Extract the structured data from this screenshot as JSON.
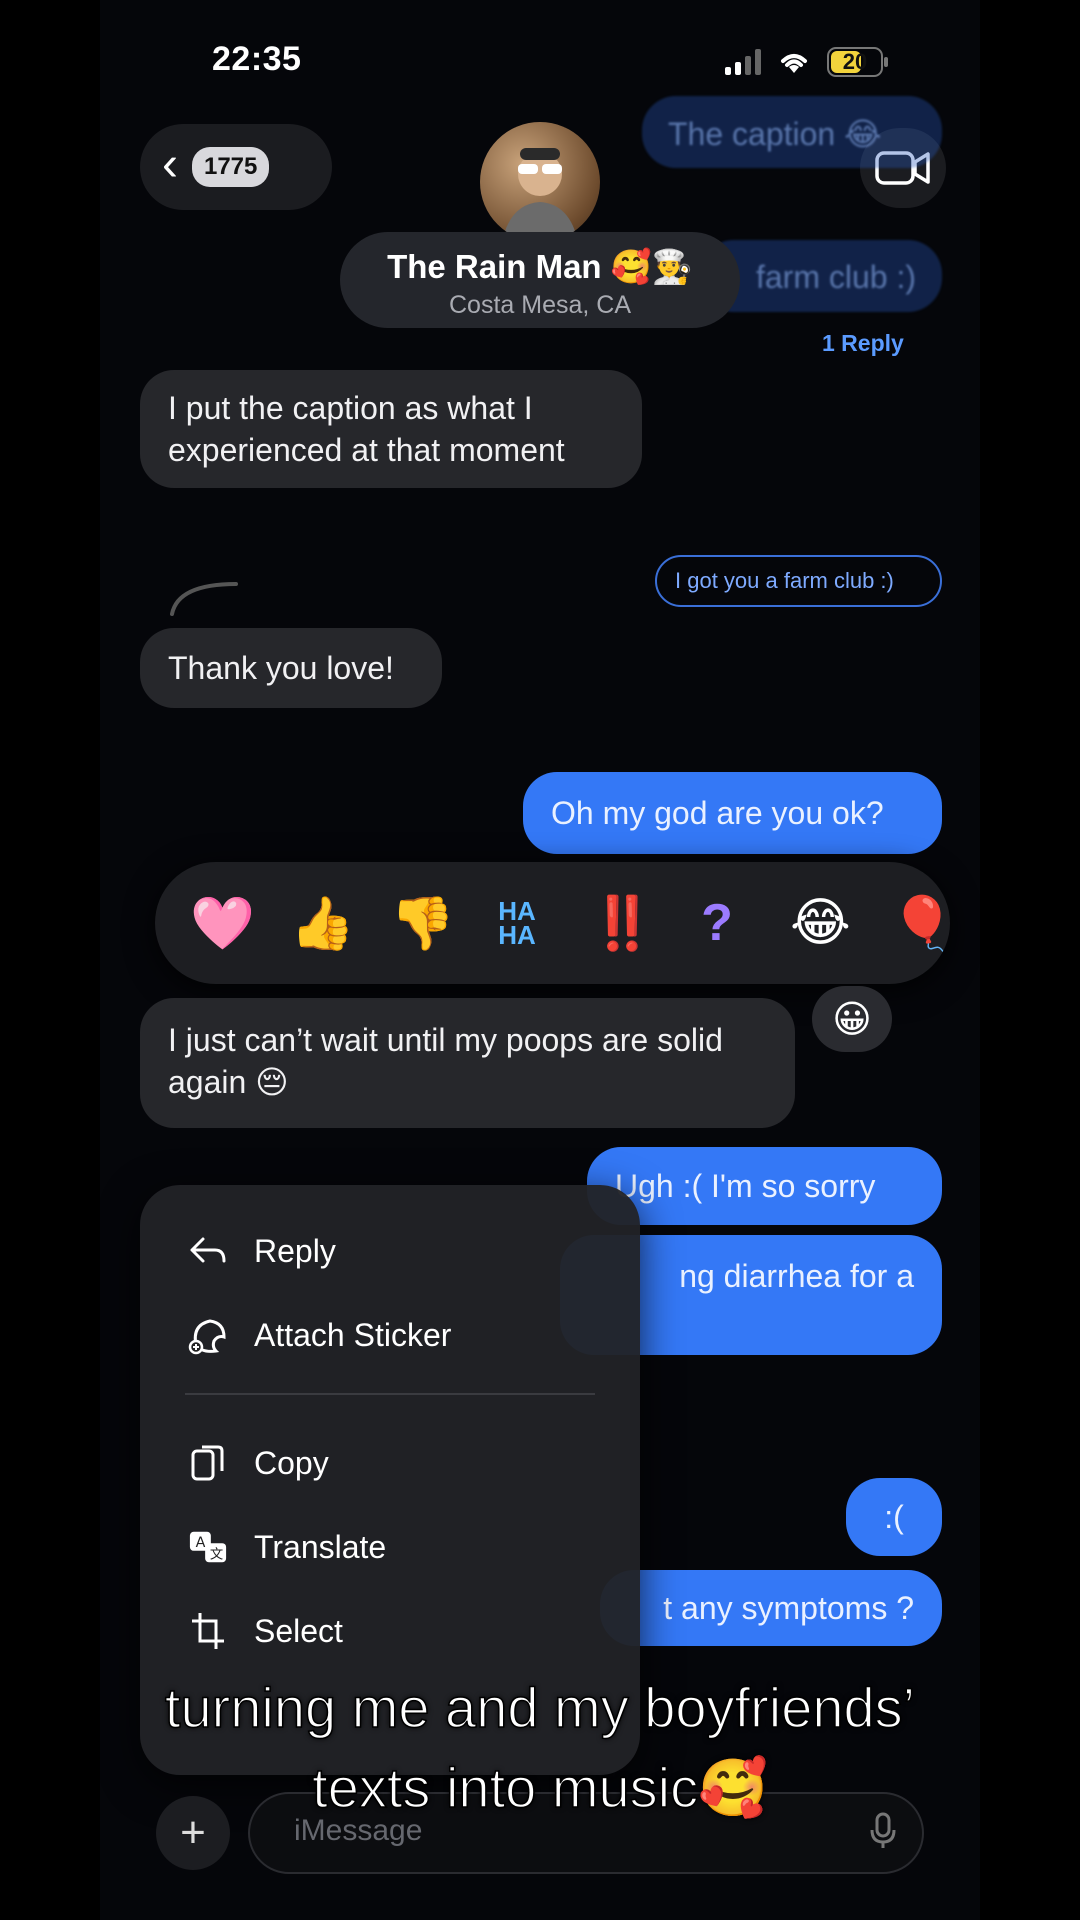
{
  "status": {
    "time": "22:35",
    "battery": "20"
  },
  "header": {
    "back_count": "1775",
    "contact_name": "The Rain Man 🥰👨‍🍳",
    "contact_location": "Costa Mesa, CA"
  },
  "messages": {
    "ghost_caption": "The caption 😂",
    "ghost_farm": "farm club :)",
    "reply_count": "1 Reply",
    "in_caption": "I put the caption as what I experienced at that moment",
    "reply_preview": "I got you a farm club :)",
    "in_thanks": "Thank you love!",
    "out_ok": "Oh my god are you ok?",
    "in_poops": "I just can’t wait until my poops are solid again 😔",
    "out_sorry": "Ugh :( I'm so sorry",
    "out_diarrhea": "ng diarrhea for a",
    "out_sad": ":(",
    "out_symptoms": "t any symptoms ?"
  },
  "reactions": [
    "🩷",
    "👍",
    "👎",
    "HA HA",
    "‼️",
    "?",
    "😂",
    "🎈"
  ],
  "reaction_more": "😀",
  "menu": {
    "reply": "Reply",
    "attach_sticker": "Attach Sticker",
    "copy": "Copy",
    "translate": "Translate",
    "select": "Select"
  },
  "input": {
    "placeholder": "iMessage"
  },
  "caption": {
    "line1": "turning me and my boyfriends’",
    "line2": "texts into music🥰"
  },
  "colors": {
    "outgoing": "#3478f6",
    "incoming": "#26272b",
    "accent": "#5b9bff"
  }
}
